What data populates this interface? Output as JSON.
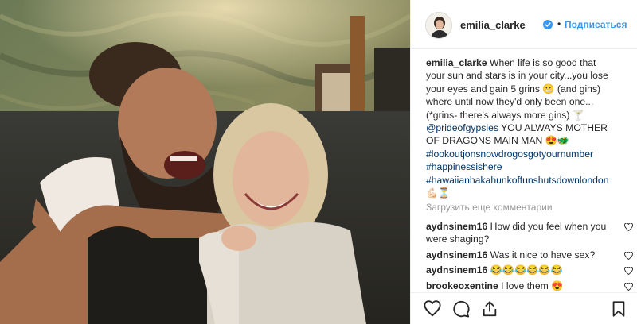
{
  "header": {
    "username": "emilia_clarke",
    "verified_icon": "verified-badge-icon",
    "separator": "•",
    "follow_label": "Подписаться",
    "accent": "#3897f0"
  },
  "caption": {
    "username": "emilia_clarke",
    "lines": [
      "When life is so good that",
      "your sun and stars is in your city...you lose",
      "your eyes and gain 5 grins 😬 (and gins)",
      "where until now they'd only been one...",
      "(*grins- there's always more gins) 🍸"
    ],
    "mention": "@prideofgypsies",
    "mention_rest": " YOU ALWAYS MOTHER",
    "line_after_mention": "OF DRAGONS MAIN MAN 😍🐲",
    "hashtags": [
      "#lookoutjonsnowdrogosgotyournumber",
      "#happinessishere",
      "#hawaiianhakahunkoffunshutsdownlondon"
    ],
    "emoji_tail": "💪🏻⏳"
  },
  "load_more_label": "Загрузить еще комментарии",
  "comments": [
    {
      "user": "aydnsinem16",
      "text": "How did you feel when you were shaging?"
    },
    {
      "user": "aydnsinem16",
      "text": "Was it nice to have sex?"
    },
    {
      "user": "aydnsinem16",
      "text": "😂😂😂😂😂😂"
    },
    {
      "user": "brookeoxentine",
      "text": "I love them 😍"
    }
  ],
  "actions": {
    "like_icon": "heart-outline-icon",
    "comment_icon": "comment-icon",
    "share_icon": "share-icon",
    "save_icon": "bookmark-icon"
  },
  "colors": {
    "text": "#262626",
    "link": "#003569",
    "muted": "#999999",
    "border": "#efefef"
  }
}
